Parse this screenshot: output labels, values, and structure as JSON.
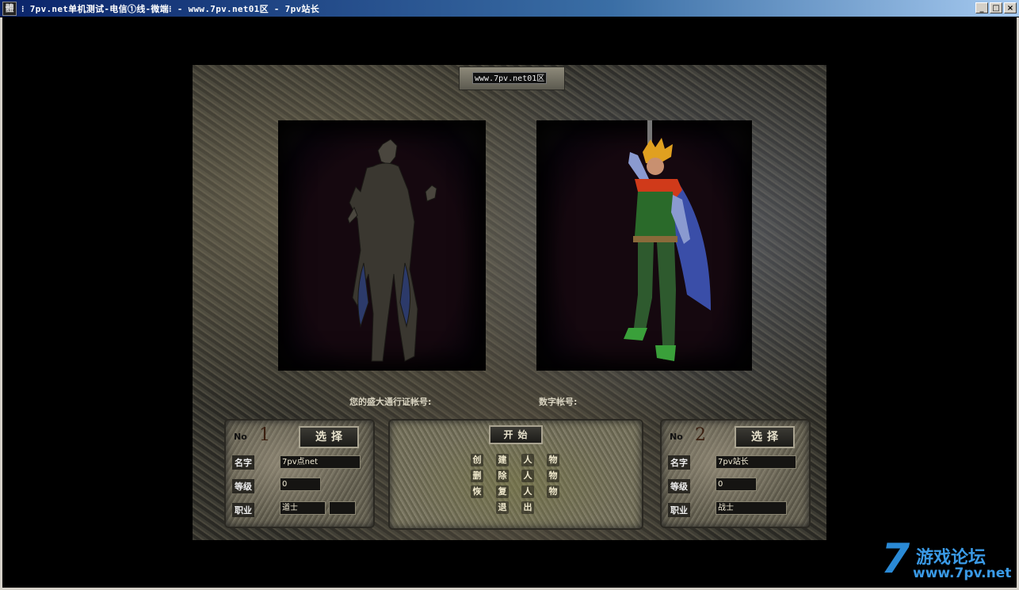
{
  "window": {
    "icon_glyph": "體",
    "title": "⁝ 7pv.net单机测试-电信①线-微端⁝ - www.7pv.net01区 - 7pv站长",
    "minimize": "_",
    "maximize": "□",
    "close": "×"
  },
  "server": {
    "name": "www.7pv.net01区"
  },
  "account": {
    "passport_label": "您的盛大通行证帐号:",
    "digit_label": "数字帐号:"
  },
  "slot1": {
    "no_label": "No",
    "no_value": "1",
    "select_label": "选择",
    "name_label": "名字",
    "name_value": "7pv点net",
    "level_label": "等级",
    "level_value": "0",
    "job_label": "职业",
    "job_value": "道士"
  },
  "slot2": {
    "no_label": "No",
    "no_value": "2",
    "select_label": "选择",
    "name_label": "名字",
    "name_value": "7pv站长",
    "level_label": "等级",
    "level_value": "0",
    "job_label": "职业",
    "job_value": "战士"
  },
  "menu": {
    "start": "开始",
    "create": [
      "创",
      "建",
      "人",
      "物"
    ],
    "delete": [
      "删",
      "除",
      "人",
      "物"
    ],
    "restore": [
      "恢",
      "复",
      "人",
      "物"
    ],
    "exit": [
      "退",
      "出"
    ]
  },
  "watermark": {
    "seven": "7",
    "title": "游戏论坛",
    "url": "www.7pv.net"
  },
  "colors": {
    "title_bar_start": "#0a246a",
    "title_bar_end": "#a6caf0",
    "watermark_blue": "#2a8ad6"
  }
}
